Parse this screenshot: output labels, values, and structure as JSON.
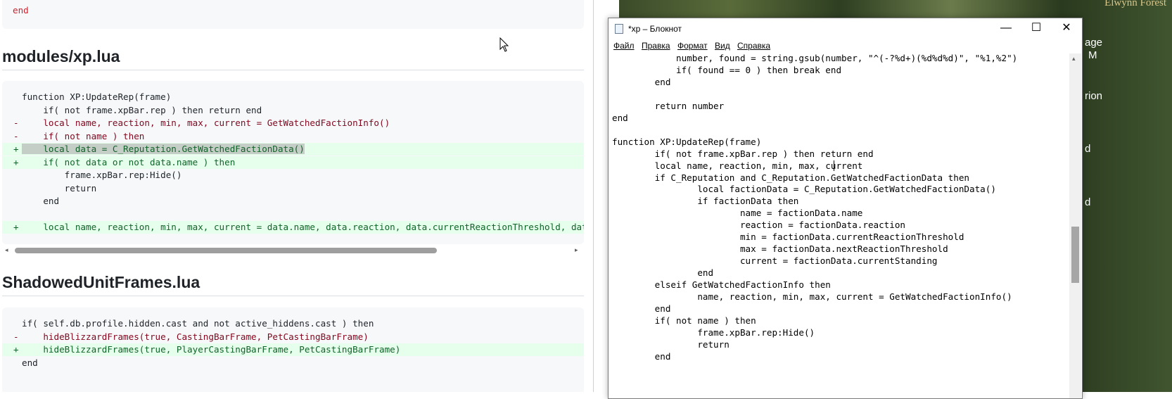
{
  "left_page": {
    "top_snippet": {
      "end_keyword": "end"
    },
    "sections": [
      {
        "heading": "modules/xp.lua",
        "lines": [
          {
            "kind": "ctx",
            "sign": "",
            "text": "function XP:UpdateRep(frame)"
          },
          {
            "kind": "ctx",
            "sign": "",
            "text": "    if( not frame.xpBar.rep ) then return end"
          },
          {
            "kind": "del",
            "sign": "-",
            "text": "    local name, reaction, min, max, current = GetWatchedFactionInfo()"
          },
          {
            "kind": "del",
            "sign": "-",
            "text": "    if( not name ) then"
          },
          {
            "kind": "add",
            "sign": "+",
            "text": "    local data = C_Reputation.GetWatchedFactionData()",
            "highlight": true
          },
          {
            "kind": "add",
            "sign": "+",
            "text": "    if( not data or not data.name ) then"
          },
          {
            "kind": "ctx",
            "sign": "",
            "text": "        frame.xpBar.rep:Hide()"
          },
          {
            "kind": "ctx",
            "sign": "",
            "text": "        return"
          },
          {
            "kind": "ctx",
            "sign": "",
            "text": "    end"
          },
          {
            "kind": "blank",
            "sign": "",
            "text": ""
          },
          {
            "kind": "add",
            "sign": "+",
            "text": "    local name, reaction, min, max, current = data.name, data.reaction, data.currentReactionThreshold, data.nextReactionThreshold"
          }
        ]
      },
      {
        "heading": "ShadowedUnitFrames.lua",
        "lines": [
          {
            "kind": "ctx",
            "sign": "",
            "text": "if( self.db.profile.hidden.cast and not active_hiddens.cast ) then"
          },
          {
            "kind": "del",
            "sign": "-",
            "text": "    hideBlizzardFrames(true, CastingBarFrame, PetCastingBarFrame)"
          },
          {
            "kind": "add",
            "sign": "+",
            "text": "    hideBlizzardFrames(true, PlayerCastingBarFrame, PetCastingBarFrame)"
          },
          {
            "kind": "ctx",
            "sign": "",
            "text": "end"
          }
        ]
      }
    ],
    "scroll_left_arrow": "◂",
    "scroll_right_arrow": "▸"
  },
  "game": {
    "zone_label": "Elwynn Forest",
    "side_fragments": [
      "age",
      "M",
      "rion",
      "d",
      "d"
    ]
  },
  "notepad": {
    "title": "*xp – Блокнот",
    "buttons": {
      "minimize": "—",
      "maximize": "☐",
      "close": "✕"
    },
    "menu": [
      "Файл",
      "Правка",
      "Формат",
      "Вид",
      "Справка"
    ],
    "lines": [
      "            number, found = string.gsub(number, \"^(-?%d+)(%d%d%d)\", \"%1,%2\")",
      "            if( found == 0 ) then break end",
      "        end",
      "",
      "        return number",
      "end",
      "",
      "function XP:UpdateRep(frame)",
      "        if( not frame.xpBar.rep ) then return end",
      "        local name, reaction, min, max, current",
      "        if C_Reputation and C_Reputation.GetWatchedFactionData then",
      "                local factionData = C_Reputation.GetWatchedFactionData()",
      "                if factionData then",
      "                        name = factionData.name",
      "                        reaction = factionData.reaction",
      "                        min = factionData.currentReactionThreshold",
      "                        max = factionData.nextReactionThreshold",
      "                        current = factionData.currentStanding",
      "                end",
      "        elseif GetWatchedFactionInfo then",
      "                name, reaction, min, max, current = GetWatchedFactionInfo()",
      "        end",
      "        if( not name ) then",
      "                frame.xpBar.rep:Hide()",
      "                return",
      "        end"
    ],
    "scroll_up_arrow": "▴"
  },
  "colors": {
    "code_bg": "#f6f8fa",
    "add_bg": "#e6ffec",
    "add_fg": "#116329",
    "del_fg": "#82071e"
  },
  "icons": [
    "notepad-icon",
    "mouse-cursor-icon"
  ]
}
